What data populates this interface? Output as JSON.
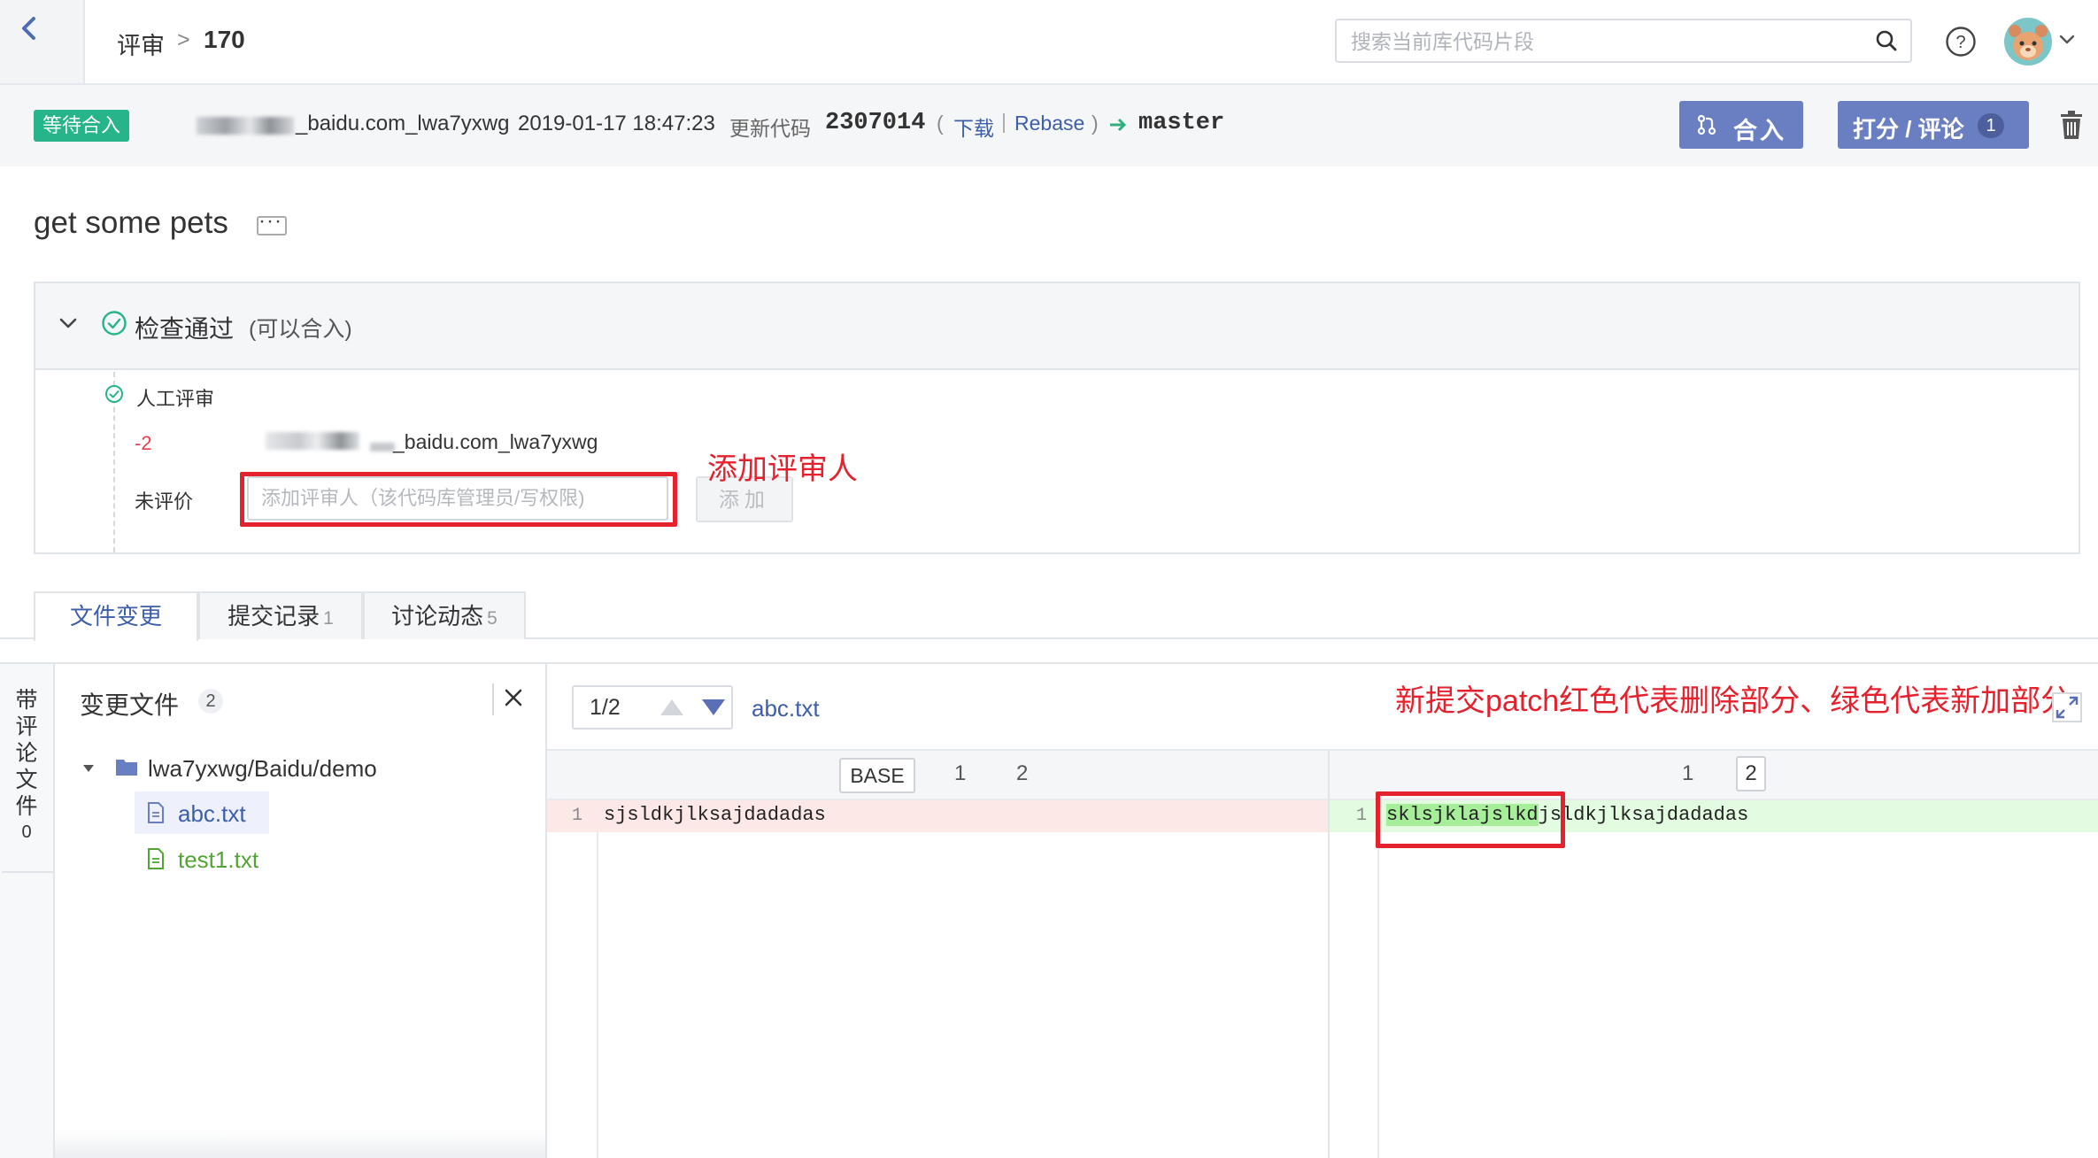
{
  "header": {
    "breadcrumb_label": "评审",
    "breadcrumb_sep": ">",
    "review_number": "170",
    "search_placeholder": "搜索当前库代码片段"
  },
  "merge_bar": {
    "status": "等待合入",
    "author": "_baidu.com_lwa7yxwg",
    "date": "2019-01-17 18:47:23",
    "update_label": "更新代码",
    "commit": "2307014",
    "paren_open": "(",
    "download": "下载",
    "pipe": "|",
    "rebase": "Rebase",
    "paren_close": ")",
    "branch": "master",
    "merge_button": "合入",
    "score_button": "打分 / 评论",
    "score_count": "1"
  },
  "review": {
    "title": "get some pets",
    "more": "···"
  },
  "check": {
    "title": "检查通过",
    "subtitle": "(可以合入)",
    "manual_label": "人工评审",
    "vote_value": "-2",
    "reviewer_name": "_baidu.com_lwa7yxwg",
    "unrated_label": "未评价",
    "reviewer_placeholder": "添加评审人（该代码库管理员/写权限)",
    "add_button": "添加"
  },
  "annotations": {
    "add_reviewer": "添加评审人",
    "patch_note": "新提交patch红色代表删除部分、绿色代表新加部分"
  },
  "tabs": [
    {
      "label": "文件变更",
      "count": ""
    },
    {
      "label": "提交记录",
      "count": "1"
    },
    {
      "label": "讨论动态",
      "count": "5"
    }
  ],
  "side_rail": {
    "label": "带评论文件",
    "count": "0"
  },
  "files_panel": {
    "title": "变更文件",
    "count": "2",
    "folder": "lwa7yxwg/Baidu/demo",
    "files": [
      "abc.txt",
      "test1.txt"
    ]
  },
  "diff": {
    "page": "1/2",
    "current_file": "abc.txt",
    "base_label": "BASE",
    "left_versions": [
      "1",
      "2"
    ],
    "right_versions": [
      "1",
      "2"
    ],
    "left_line_number": "1",
    "left_code": "sjsldkjlksajdadadas",
    "right_line_number": "1",
    "right_code_added": "sklsjklajslkd",
    "right_code_rest": "jsldkjlksajdadadas",
    "colors": {
      "deleted_bg": "#fde8e8",
      "added_bg": "#e3fbe0",
      "added_highlight": "#a6ee9a",
      "accent": "#6a7fc1",
      "status_green": "#27b48a",
      "annotation_red": "#e5212d"
    }
  }
}
